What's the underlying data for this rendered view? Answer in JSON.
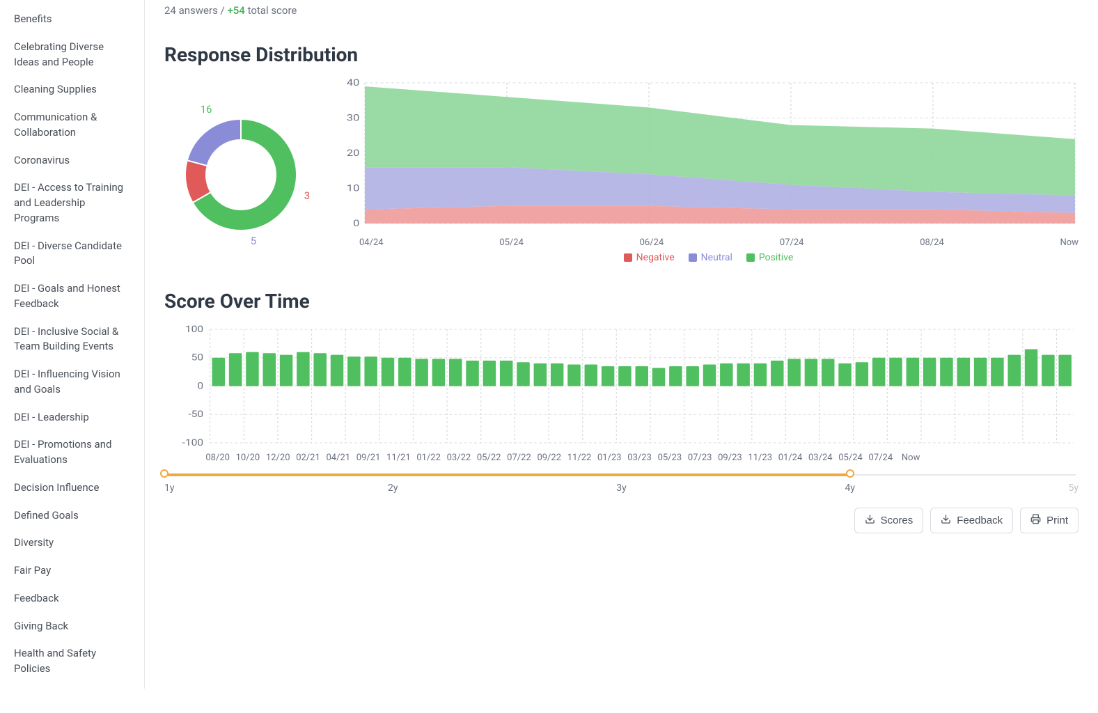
{
  "sidebar": {
    "items": [
      "Benefits",
      "Celebrating Diverse Ideas and People",
      "Cleaning Supplies",
      "Communication & Collaboration",
      "Coronavirus",
      "DEI - Access to Training and Leadership Programs",
      "DEI - Diverse Candidate Pool",
      "DEI - Goals and Honest Feedback",
      "DEI - Inclusive Social & Team Building Events",
      "DEI - Influencing Vision and Goals",
      "DEI - Leadership",
      "DEI - Promotions and Evaluations",
      "Decision Influence",
      "Defined Goals",
      "Diversity",
      "Fair Pay",
      "Feedback",
      "Giving Back",
      "Health and Safety Policies"
    ]
  },
  "meta": {
    "answers_prefix": "24 answers / ",
    "score_value": "+54",
    "score_suffix": " total score"
  },
  "sections": {
    "response_distribution": "Response Distribution",
    "score_over_time": "Score Over Time"
  },
  "legend": {
    "negative": "Negative",
    "neutral": "Neutral",
    "positive": "Positive"
  },
  "colors": {
    "negative": "#e05a5a",
    "neutral": "#8a8cd8",
    "positive": "#4fbf5f",
    "accent_orange": "#f0a840"
  },
  "donut_labels": {
    "pos": "16",
    "neu": "5",
    "neg": "3"
  },
  "slider": {
    "ticks": [
      "1y",
      "2y",
      "3y",
      "4y",
      "5y"
    ],
    "active_index": 3
  },
  "buttons": {
    "scores": "Scores",
    "feedback": "Feedback",
    "print": "Print"
  },
  "chart_data": [
    {
      "type": "pie",
      "title": "Response Distribution (current)",
      "series": [
        {
          "name": "Positive",
          "value": 16,
          "color": "#4fbf5f"
        },
        {
          "name": "Neutral",
          "value": 5,
          "color": "#8a8cd8"
        },
        {
          "name": "Negative",
          "value": 3,
          "color": "#e05a5a"
        }
      ]
    },
    {
      "type": "area",
      "title": "Response Distribution over time (stacked)",
      "x": [
        "04/24",
        "05/24",
        "06/24",
        "07/24",
        "08/24",
        "Now"
      ],
      "ylim": [
        0,
        40
      ],
      "yticks": [
        0,
        10,
        20,
        30,
        40
      ],
      "series": [
        {
          "name": "Negative",
          "color": "#e05a5a",
          "values": [
            4,
            5,
            5,
            4,
            4,
            3
          ]
        },
        {
          "name": "Neutral",
          "color": "#8a8cd8",
          "values": [
            12,
            11,
            9,
            7,
            5,
            5
          ]
        },
        {
          "name": "Positive",
          "color": "#4fbf5f",
          "values": [
            23,
            20,
            19,
            17,
            18,
            16
          ]
        }
      ]
    },
    {
      "type": "bar",
      "title": "Score Over Time",
      "ylim": [
        -100,
        100
      ],
      "yticks": [
        -100,
        -50,
        0,
        50,
        100
      ],
      "x_major": [
        "08/20",
        "10/20",
        "12/20",
        "02/21",
        "04/21",
        "09/21",
        "11/21",
        "01/22",
        "03/22",
        "05/22",
        "07/22",
        "09/22",
        "11/22",
        "01/23",
        "03/23",
        "05/23",
        "07/23",
        "09/23",
        "11/23",
        "01/24",
        "03/24",
        "05/24",
        "07/24",
        "Now"
      ],
      "categories": [
        "07/20",
        "08/20",
        "09/20",
        "10/20",
        "11/20",
        "12/20",
        "01/21",
        "02/21",
        "03/21",
        "04/21",
        "05/21",
        "06/21",
        "07/21",
        "08/21",
        "09/21",
        "10/21",
        "11/21",
        "12/21",
        "01/22",
        "02/22",
        "03/22",
        "04/22",
        "05/22",
        "06/22",
        "07/22",
        "08/22",
        "09/22",
        "10/22",
        "11/22",
        "12/22",
        "01/23",
        "02/23",
        "03/23",
        "04/23",
        "05/23",
        "06/23",
        "07/23",
        "08/23",
        "09/23",
        "10/23",
        "11/23",
        "12/23",
        "01/24",
        "02/24",
        "03/24",
        "04/24",
        "05/24",
        "06/24",
        "07/24",
        "08/24",
        "Now"
      ],
      "values": [
        50,
        58,
        60,
        58,
        55,
        60,
        58,
        55,
        52,
        52,
        50,
        50,
        48,
        48,
        48,
        45,
        45,
        45,
        42,
        40,
        40,
        38,
        38,
        35,
        35,
        35,
        32,
        35,
        35,
        38,
        40,
        40,
        40,
        45,
        48,
        48,
        48,
        40,
        42,
        50,
        50,
        50,
        50,
        50,
        50,
        50,
        50,
        55,
        65,
        55,
        55
      ],
      "color": "#4fbf5f"
    }
  ]
}
